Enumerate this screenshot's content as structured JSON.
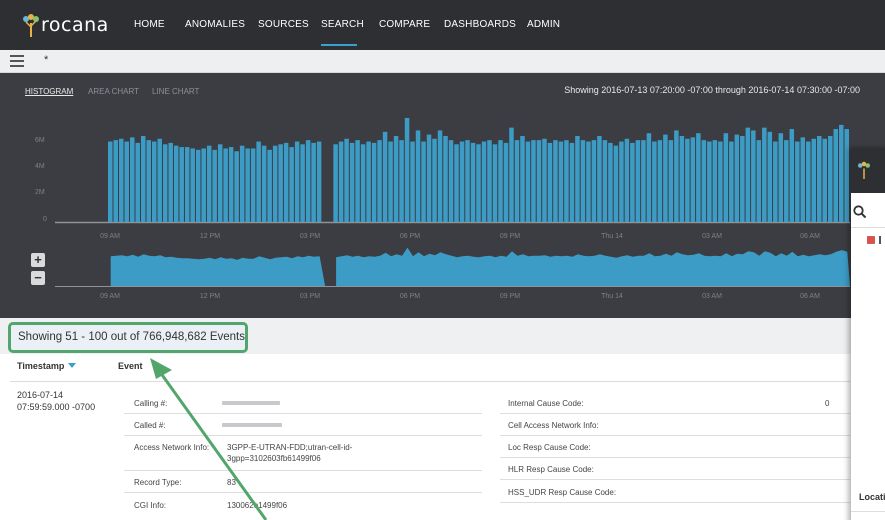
{
  "app": {
    "logo_text": "rocana"
  },
  "nav": {
    "items": [
      {
        "label": "HOME"
      },
      {
        "label": "ANOMALIES"
      },
      {
        "label": "SOURCES"
      },
      {
        "label": "SEARCH",
        "active": true
      },
      {
        "label": "COMPARE"
      },
      {
        "label": "DASHBOARDS"
      },
      {
        "label": "ADMIN"
      }
    ]
  },
  "toolbar": {
    "tab_label": "*",
    "menu_icon": "hamburger-icon"
  },
  "chart_panel": {
    "tabs": [
      {
        "label": "HISTOGRAM",
        "active": true
      },
      {
        "label": "AREA CHART"
      },
      {
        "label": "LINE CHART"
      }
    ],
    "range_text": "Showing 2016-07-13 07:20:00 -07:00 through 2016-07-14 07:30:00 -07:00",
    "zoom_in": "+",
    "zoom_out": "−"
  },
  "chart_data": {
    "type": "bar",
    "yticks": [
      "6M",
      "4M",
      "2M",
      "0"
    ],
    "ylim": [
      0,
      8
    ],
    "xticks": [
      "09 AM",
      "12 PM",
      "03 PM",
      "06 PM",
      "09 PM",
      "Thu 14",
      "03 AM",
      "06 AM"
    ],
    "series": [
      {
        "values": [
          5.8,
          5.9,
          6.0,
          5.8,
          6.1,
          5.7,
          6.2,
          5.9,
          5.8,
          6.0,
          5.6,
          5.7,
          5.5,
          5.4,
          5.4,
          5.3,
          5.2,
          5.3,
          5.5,
          5.2,
          5.6,
          5.3,
          5.4,
          5.1,
          5.5,
          5.3,
          5.3,
          5.8,
          5.5,
          5.2,
          5.5,
          5.6,
          5.7,
          5.4,
          5.8,
          5.6,
          5.9,
          5.7,
          5.8,
          0,
          0,
          5.6,
          5.8,
          6.0,
          5.7,
          5.9,
          5.6,
          5.8,
          5.7,
          5.9,
          6.5,
          5.8,
          6.2,
          5.9,
          7.5,
          5.8,
          6.6,
          5.8,
          6.3,
          6.0,
          6.6,
          6.2,
          5.9,
          5.6,
          5.8,
          5.9,
          5.7,
          5.6,
          5.8,
          5.9,
          5.6,
          5.9,
          5.7,
          6.8,
          5.9,
          6.2,
          5.8,
          5.9,
          5.9,
          6.0,
          5.7,
          5.9,
          5.8,
          5.9,
          5.7,
          6.2,
          5.9,
          5.8,
          5.9,
          6.2,
          5.9,
          5.7,
          5.5,
          5.8,
          6.0,
          5.7,
          5.9,
          5.9,
          6.4,
          5.8,
          5.9,
          6.3,
          5.9,
          6.6,
          6.2,
          6.0,
          6.1,
          6.4,
          5.9,
          5.8,
          5.9,
          5.8,
          6.4,
          5.8,
          6.3,
          6.2,
          6.8,
          6.6,
          5.9,
          6.8,
          6.5,
          5.8,
          6.4,
          5.9,
          6.7,
          5.8,
          6.1,
          5.8,
          6.0,
          6.2,
          6.0,
          6.2,
          6.7,
          7.0,
          6.7
        ]
      }
    ],
    "overview_xticks": [
      "09 AM",
      "12 PM",
      "03 PM",
      "06 PM",
      "09 PM",
      "Thu 14",
      "03 AM",
      "06 AM"
    ]
  },
  "results": {
    "showing_text": "Showing 51 - 100 out of 766,948,682 Events"
  },
  "table": {
    "columns": [
      {
        "label": "Timestamp",
        "sorted": true
      },
      {
        "label": "Event"
      }
    ],
    "row": {
      "timestamp_date": "2016-07-14",
      "timestamp_time": "07:59:59.000 -0700",
      "left_fields": [
        {
          "label": "Calling #:",
          "value": "",
          "redacted": true
        },
        {
          "label": "Called #:",
          "value": "",
          "redacted": true
        },
        {
          "label": "Access Network Info:",
          "value": "3GPP-E-UTRAN-FDD;utran-cell-id-3gpp=3102603fb61499f06"
        },
        {
          "label": "Record Type:",
          "value": "83"
        },
        {
          "label": "CGI Info:",
          "value": "130062e1499f06"
        }
      ],
      "right_fields": [
        {
          "label": "Internal Cause Code:",
          "value": "0"
        },
        {
          "label": "Cell Access Network Info:",
          "value": ""
        },
        {
          "label": "Loc Resp Cause Code:",
          "value": ""
        },
        {
          "label": "HLR Resp Cause Code:",
          "value": ""
        },
        {
          "label": "HSS_UDR Resp Cause Code:",
          "value": ""
        }
      ]
    }
  },
  "side_panel": {
    "footer_label": "Locati"
  },
  "colors": {
    "nav_bg": "#2d2f33",
    "chart_bg": "#3b3d42",
    "bar": "#3c9cc6",
    "accent": "#3aa0cf",
    "highlight": "#53a66b"
  }
}
